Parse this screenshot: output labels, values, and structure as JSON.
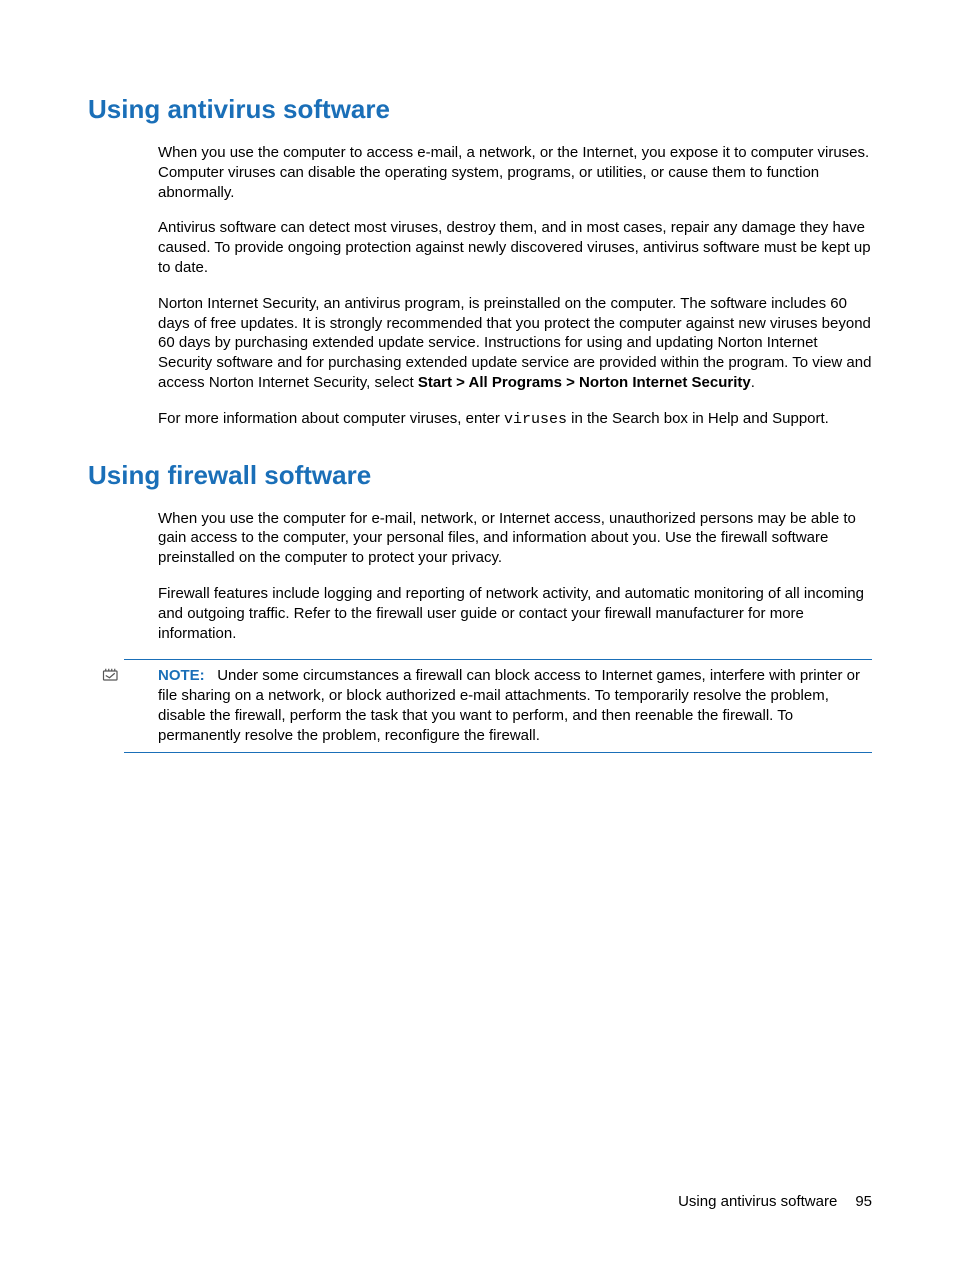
{
  "section1": {
    "heading": "Using antivirus software",
    "p1": "When you use the computer to access e-mail, a network, or the Internet, you expose it to computer viruses. Computer viruses can disable the operating system, programs, or utilities, or cause them to function abnormally.",
    "p2": "Antivirus software can detect most viruses, destroy them, and in most cases, repair any damage they have caused. To provide ongoing protection against newly discovered viruses, antivirus software must be kept up to date.",
    "p3a": "Norton Internet Security, an antivirus program, is preinstalled on the computer. The software includes 60 days of free updates. It is strongly recommended that you protect the computer against new viruses beyond 60 days by purchasing extended update service. Instructions for using and updating Norton Internet Security software and for purchasing extended update service are provided within the program. To view and access Norton Internet Security, select ",
    "p3bold": "Start > All Programs > Norton Internet Security",
    "p3b": ".",
    "p4a": "For more information about computer viruses, enter ",
    "p4code": "viruses",
    "p4b": " in the Search box in Help and Support."
  },
  "section2": {
    "heading": "Using firewall software",
    "p1": "When you use the computer for e-mail, network, or Internet access, unauthorized persons may be able to gain access to the computer, your personal files, and information about you. Use the firewall software preinstalled on the computer to protect your privacy.",
    "p2": "Firewall features include logging and reporting of network activity, and automatic monitoring of all incoming and outgoing traffic. Refer to the firewall user guide or contact your firewall manufacturer for more information.",
    "note_label": "NOTE:",
    "note_text": "Under some circumstances a firewall can block access to Internet games, interfere with printer or file sharing on a network, or block authorized e-mail attachments. To temporarily resolve the problem, disable the firewall, perform the task that you want to perform, and then reenable the firewall. To permanently resolve the problem, reconfigure the firewall."
  },
  "footer": {
    "title": "Using antivirus software",
    "page": "95"
  }
}
